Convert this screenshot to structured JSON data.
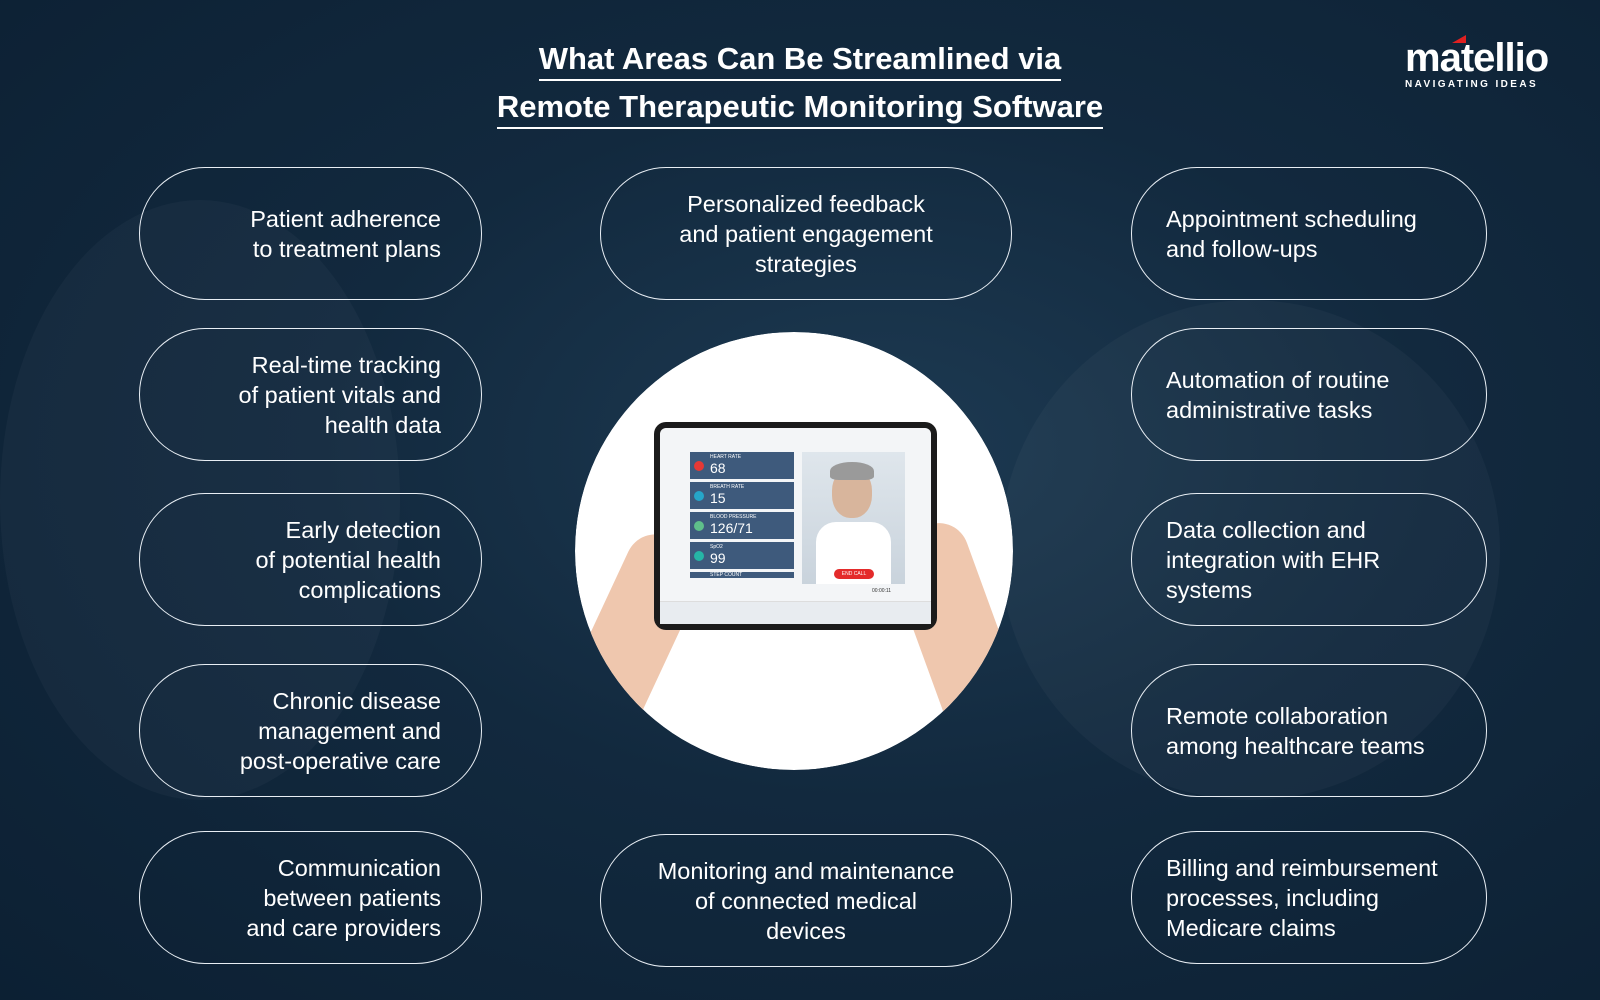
{
  "title": {
    "line1": "What Areas Can Be Streamlined via",
    "line2": "Remote Therapeutic Monitoring Software"
  },
  "logo": {
    "word": "matellio",
    "tagline": "NAVIGATING IDEAS",
    "accent": "#e02020"
  },
  "left": [
    "Patient adherence\nto treatment plans",
    "Real-time tracking\nof patient vitals and\nhealth data",
    "Early detection\nof potential health\ncomplications",
    "Chronic disease\nmanagement and\npost-operative care",
    "Communication\nbetween patients\nand care providers"
  ],
  "center": [
    "Personalized feedback\nand patient engagement\nstrategies",
    "Monitoring and maintenance\nof connected medical\ndevices"
  ],
  "right": [
    "Appointment scheduling\nand follow-ups",
    "Automation of routine\nadministrative tasks",
    "Data collection and\nintegration with EHR\nsystems",
    "Remote collaboration\namong healthcare teams",
    "Billing and reimbursement\nprocesses, including\nMedicare claims"
  ],
  "tablet": {
    "vitals": [
      {
        "label": "HEART RATE",
        "value": "68",
        "color": "#e53935"
      },
      {
        "label": "BREATH RATE",
        "value": "15",
        "color": "#26a6c9"
      },
      {
        "label": "BLOOD PRESSURE",
        "value": "126/71",
        "color": "#5fbf8a"
      },
      {
        "label": "SpO2",
        "value": "99",
        "color": "#26b5a6"
      },
      {
        "label": "STEP COUNT",
        "value": "",
        "color": "#3e5a7c"
      }
    ],
    "end_call": "END CALL",
    "timer": "00:00:11"
  },
  "colors": {
    "background": "#12293e",
    "pill_border": "#e8eef4"
  }
}
